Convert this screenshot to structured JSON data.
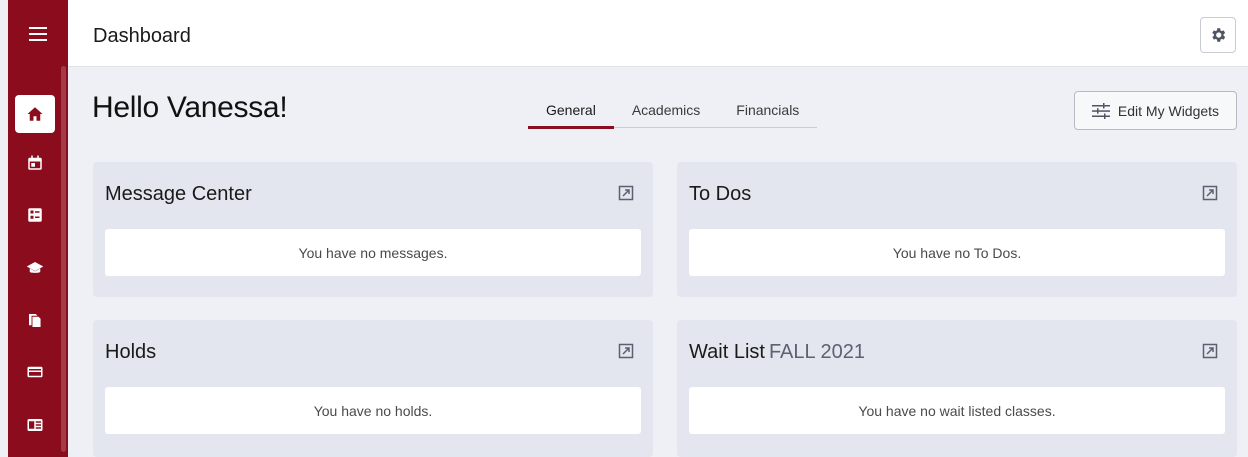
{
  "header": {
    "title": "Dashboard",
    "settings_icon": "gear-icon"
  },
  "sidebar": {
    "menu_icon": "hamburger-menu-icon",
    "items": [
      {
        "name": "home",
        "icon": "home-icon",
        "active": true
      },
      {
        "name": "calendar",
        "icon": "calendar-icon",
        "active": false
      },
      {
        "name": "grid-list",
        "icon": "list-grid-icon",
        "active": false
      },
      {
        "name": "academics",
        "icon": "graduation-cap-icon",
        "active": false
      },
      {
        "name": "documents",
        "icon": "documents-icon",
        "active": false
      },
      {
        "name": "payments",
        "icon": "credit-card-icon",
        "active": false
      },
      {
        "name": "news",
        "icon": "newspaper-icon",
        "active": false
      }
    ]
  },
  "greeting": "Hello Vanessa!",
  "tabs": [
    {
      "label": "General",
      "active": true
    },
    {
      "label": "Academics",
      "active": false
    },
    {
      "label": "Financials",
      "active": false
    }
  ],
  "edit_widgets_label": "Edit My Widgets",
  "widgets": {
    "message_center": {
      "title": "Message Center",
      "body": "You have no messages."
    },
    "todos": {
      "title": "To Dos",
      "body": "You have no To Dos."
    },
    "holds": {
      "title": "Holds",
      "body": "You have no holds."
    },
    "wait_list": {
      "title": "Wait List",
      "term": "FALL 2021",
      "body": "You have no wait listed classes."
    }
  },
  "colors": {
    "brand": "#8b0d1d",
    "page_bg": "#eef0f5",
    "widget_bg": "#e3e6ee"
  }
}
